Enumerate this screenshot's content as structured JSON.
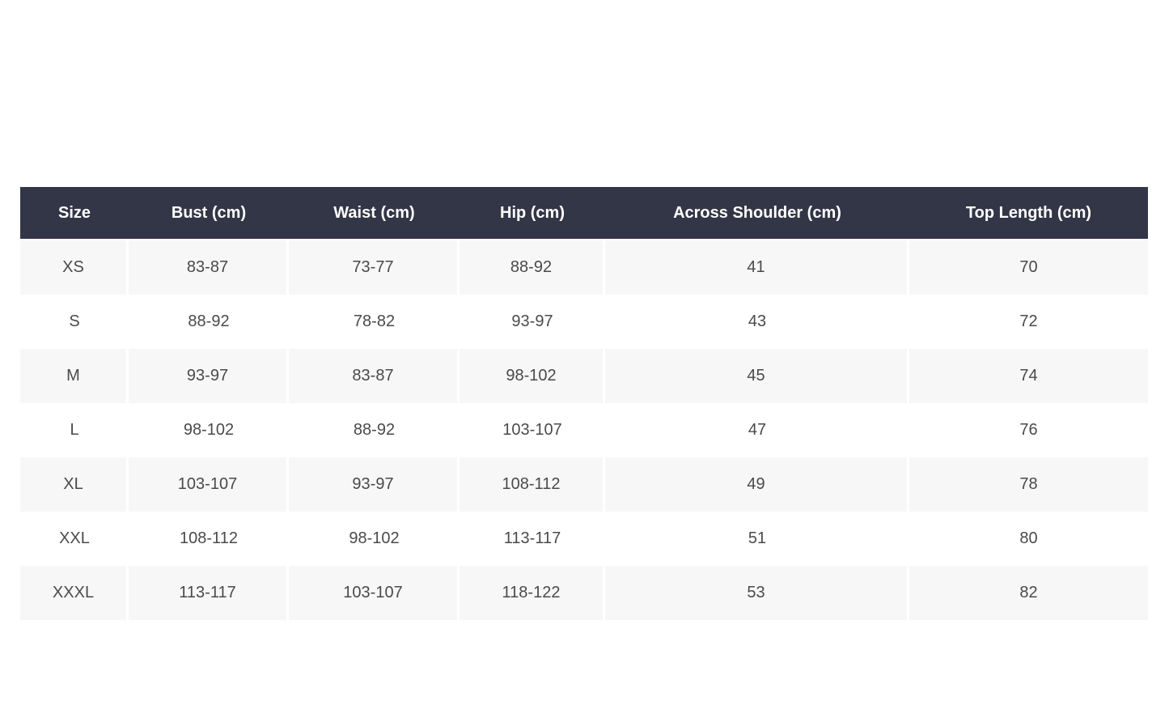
{
  "table": {
    "headers": [
      "Size",
      "Bust (cm)",
      "Waist (cm)",
      "Hip (cm)",
      "Across Shoulder (cm)",
      "Top Length (cm)"
    ],
    "rows": [
      [
        "XS",
        "83-87",
        "73-77",
        "88-92",
        "41",
        "70"
      ],
      [
        "S",
        "88-92",
        "78-82",
        "93-97",
        "43",
        "72"
      ],
      [
        "M",
        "93-97",
        "83-87",
        "98-102",
        "45",
        "74"
      ],
      [
        "L",
        "98-102",
        "88-92",
        "103-107",
        "47",
        "76"
      ],
      [
        "XL",
        "103-107",
        "93-97",
        "108-112",
        "49",
        "78"
      ],
      [
        "XXL",
        "108-112",
        "98-102",
        "113-117",
        "51",
        "80"
      ],
      [
        "XXXL",
        "113-117",
        "103-107",
        "118-122",
        "53",
        "82"
      ]
    ]
  },
  "colors": {
    "header_background": "#333646",
    "header_text": "#ffffff",
    "stripe_background": "#f7f7f7",
    "body_text": "#4a4a4a"
  }
}
